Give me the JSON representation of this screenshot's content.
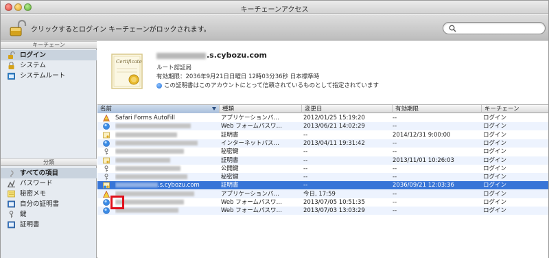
{
  "window": {
    "title": "キーチェーンアクセス"
  },
  "toolbar": {
    "lock_message": "クリックするとログイン キーチェーンがロックされます。",
    "search_placeholder": "Q"
  },
  "sidebar": {
    "keychains_header": "キーチェーン",
    "keychains": [
      {
        "label": "ログイン",
        "icon": "keychain-icon",
        "selected": true
      },
      {
        "label": "システム",
        "icon": "keychain-icon",
        "selected": false
      },
      {
        "label": "システムルート",
        "icon": "folder-icon",
        "selected": false
      }
    ],
    "category_header": "分類",
    "categories": [
      {
        "label": "すべての項目",
        "icon": "all-items-icon",
        "selected": true
      },
      {
        "label": "パスワード",
        "icon": "password-icon",
        "selected": false
      },
      {
        "label": "秘密メモ",
        "icon": "secure-note-icon",
        "selected": false
      },
      {
        "label": "自分の証明書",
        "icon": "my-certificate-icon",
        "selected": false
      },
      {
        "label": "鍵",
        "icon": "key-icon",
        "selected": false
      },
      {
        "label": "証明書",
        "icon": "certificate-icon",
        "selected": false
      }
    ]
  },
  "detail": {
    "name_suffix": ".s.cybozu.com",
    "kind": "ルート認証局",
    "expiry": "有効期限：2036年9月21日日曜日 12時03分36秒 日本標準時",
    "trust": "この証明書はこのアカウントにとって信頼されているものとして指定されています"
  },
  "table": {
    "headers": {
      "name": "名前",
      "kind": "種類",
      "modified": "変更日",
      "expires": "有効期限",
      "keychain": "キーチェーン"
    },
    "rows": [
      {
        "icon": "safari-forms-icon",
        "name": "Safari Forms AutoFill",
        "kind": "アプリケーションパ…",
        "modified": "2012/01/25 15:19:20",
        "expires": "--",
        "keychain": "ログイン"
      },
      {
        "icon": "web-password-icon",
        "name": "",
        "kind": "Web フォームパスワ…",
        "modified": "2013/06/21 14:02:29",
        "expires": "--",
        "keychain": "ログイン"
      },
      {
        "icon": "certificate-icon",
        "name": "",
        "kind": "証明書",
        "modified": "--",
        "expires": "2014/12/31 9:00:00",
        "keychain": "ログイン"
      },
      {
        "icon": "internet-password-icon",
        "name": "",
        "kind": "インターネットパス…",
        "modified": "2013/04/11 19:31:42",
        "expires": "--",
        "keychain": "ログイン"
      },
      {
        "icon": "private-key-icon",
        "name": "",
        "kind": "秘密鍵",
        "modified": "--",
        "expires": "--",
        "keychain": "ログイン"
      },
      {
        "icon": "certificate-icon",
        "name": "",
        "kind": "証明書",
        "modified": "--",
        "expires": "2013/11/01 10:26:03",
        "keychain": "ログイン"
      },
      {
        "icon": "public-key-icon",
        "name": "",
        "kind": "公開鍵",
        "modified": "--",
        "expires": "--",
        "keychain": "ログイン"
      },
      {
        "icon": "private-key-icon",
        "name": "",
        "kind": "秘密鍵",
        "modified": "--",
        "expires": "--",
        "keychain": "ログイン"
      },
      {
        "icon": "root-certificate-icon",
        "name": ".s.cybozu.com",
        "kind": "証明書",
        "modified": "--",
        "expires": "2036/09/21 12:03:36",
        "keychain": "ログイン",
        "selected": true
      },
      {
        "icon": "application-password-icon",
        "name": "",
        "kind": "アプリケーションパ…",
        "modified": "今日, 17:59",
        "expires": "--",
        "keychain": "ログイン"
      },
      {
        "icon": "web-password-icon",
        "name": "",
        "kind": "Web フォームパスワ…",
        "modified": "2013/07/05 10:51:35",
        "expires": "--",
        "keychain": "ログイン"
      },
      {
        "icon": "web-password-icon",
        "name": "",
        "kind": "Web フォームパスワ…",
        "modified": "2013/07/03 13:03:29",
        "expires": "--",
        "keychain": "ログイン"
      }
    ]
  },
  "colors": {
    "selection": "#3875d7",
    "highlight_box": "#e0101b",
    "sidebar_bg": "#e6ebf1"
  }
}
